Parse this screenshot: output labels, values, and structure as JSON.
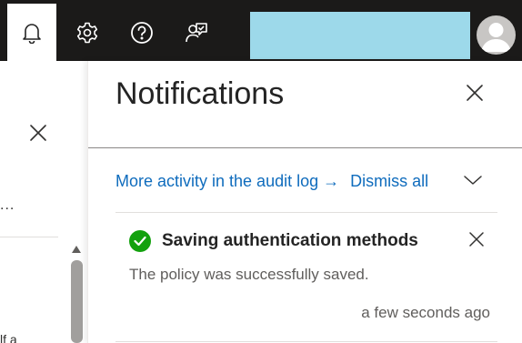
{
  "header": {
    "icons": [
      "bell-icon",
      "gear-icon",
      "help-icon",
      "feedback-icon"
    ],
    "accent_bg": "#1b1a19",
    "redaction_color": "#9dd9ea"
  },
  "left_pane": {
    "more_label": "...",
    "truncated_text": "lf a"
  },
  "notifications": {
    "title": "Notifications",
    "audit_link": "More activity in the audit log →",
    "dismiss_all": "Dismiss all",
    "link_color": "#0f6cbd",
    "items": [
      {
        "title": "Saving authentication methods",
        "message": "The policy was successfully saved.",
        "time": "a few seconds ago",
        "status": "success",
        "status_color": "#13a10e"
      }
    ]
  }
}
